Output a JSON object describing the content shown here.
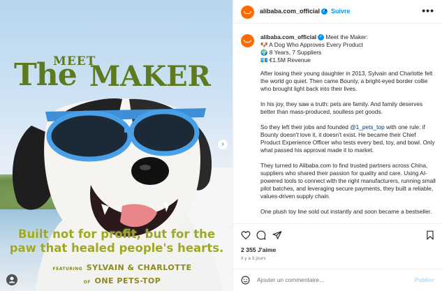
{
  "post": {
    "image": {
      "title_meet": "MEET",
      "title_the": "The",
      "title_maker": "MAKER",
      "tagline": "Built not for profit, but for the paw that healed people's hearts.",
      "featuring_label": "FEATURING",
      "featuring_names": "SYLVAIN & CHARLOTTE",
      "of_label": "OF",
      "brand": "ONE PETS-TOP",
      "next_icon": "chevron-right-icon",
      "tag_icon": "user-tag-icon"
    },
    "header": {
      "username": "alibaba.com_official",
      "separator": "•",
      "follow_label": "Suivre",
      "more_label": "•••"
    },
    "caption": {
      "username": "alibaba.com_official",
      "line1": "Meet the Maker:",
      "line2": "🐶 A Dog Who Approves Every Product",
      "line3": "🌍 8 Years, 7 Suppliers",
      "line4": "💶 €1.5M Revenue",
      "p1": "After losing their young daughter in 2013, Sylvain and Charlotte felt the world go quiet. Then came Bounty, a bright-eyed border collie who brought light back into their lives.",
      "p2": "In his joy, they saw a truth: pets are family. And family deserves better than mass-produced, soulless pet goods.",
      "p3_pre": "So they left their jobs and founded ",
      "p3_mention": "@1_pets_top",
      "p3_post": " with one rule: if Bounty doesn't love it, it doesn't exist. He became their Chief Product Experience Officer who tests every bed, toy, and bowl. Only what passed his approval made it to market.",
      "p4": "They turned to Alibaba.com to find trusted partners across China, suppliers who shared their passion for quality and care. Using AI-powered tools to connect with the right manufacturers, running small pilot batches, and leveraging secure payments, they built a reliable, values-driven supply chain.",
      "p5": "One plush toy line sold out instantly and soon became a bestseller."
    },
    "actions": {
      "like_icon": "heart-icon",
      "comment_icon": "comment-icon",
      "share_icon": "share-icon",
      "save_icon": "bookmark-icon"
    },
    "likes_text": "2 355 J'aime",
    "time_text": "Il y a 3 jours",
    "comment_box": {
      "emoji_icon": "emoji-icon",
      "placeholder": "Ajouter un commentaire…",
      "post_label": "Publier"
    },
    "colors": {
      "title_green": "#5f7a1e",
      "tagline_yellow": "#9ea825",
      "brand_orange": "#ff6a00",
      "link_blue": "#0095f6"
    }
  }
}
